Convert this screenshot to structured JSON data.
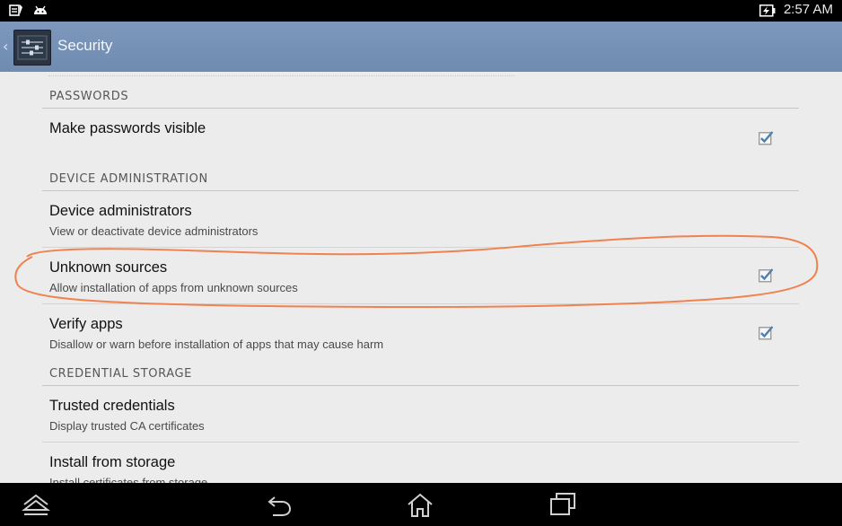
{
  "status_bar": {
    "time": "2:57 AM",
    "left_icons": [
      "notification-icon",
      "android-icon"
    ],
    "battery_icon": "battery-charging-icon"
  },
  "action_bar": {
    "title": "Security",
    "back_icon": "chevron-left-icon",
    "app_icon": "settings-app-icon",
    "color": "#7390b5"
  },
  "sections": {
    "passwords": "PASSWORDS",
    "device_administration": "DEVICE ADMINISTRATION",
    "credential_storage": "CREDENTIAL STORAGE"
  },
  "items": {
    "make_passwords_visible": {
      "title": "Make passwords visible",
      "checked": true
    },
    "device_administrators": {
      "title": "Device administrators",
      "summary": "View or deactivate device administrators"
    },
    "unknown_sources": {
      "title": "Unknown sources",
      "summary": "Allow installation of apps from unknown sources",
      "checked": true
    },
    "verify_apps": {
      "title": "Verify apps",
      "summary": "Disallow or warn before installation of apps that may cause harm",
      "checked": true
    },
    "trusted_credentials": {
      "title": "Trusted credentials",
      "summary": "Display trusted CA certificates"
    },
    "install_from_storage": {
      "title": "Install from storage",
      "summary": "Install certificates from storage"
    }
  },
  "annotation": {
    "shape": "hand-drawn-oval",
    "color": "#f0824e"
  },
  "nav_bar": [
    "hide-bar-icon",
    "back-icon",
    "home-icon",
    "recent-apps-icon"
  ]
}
